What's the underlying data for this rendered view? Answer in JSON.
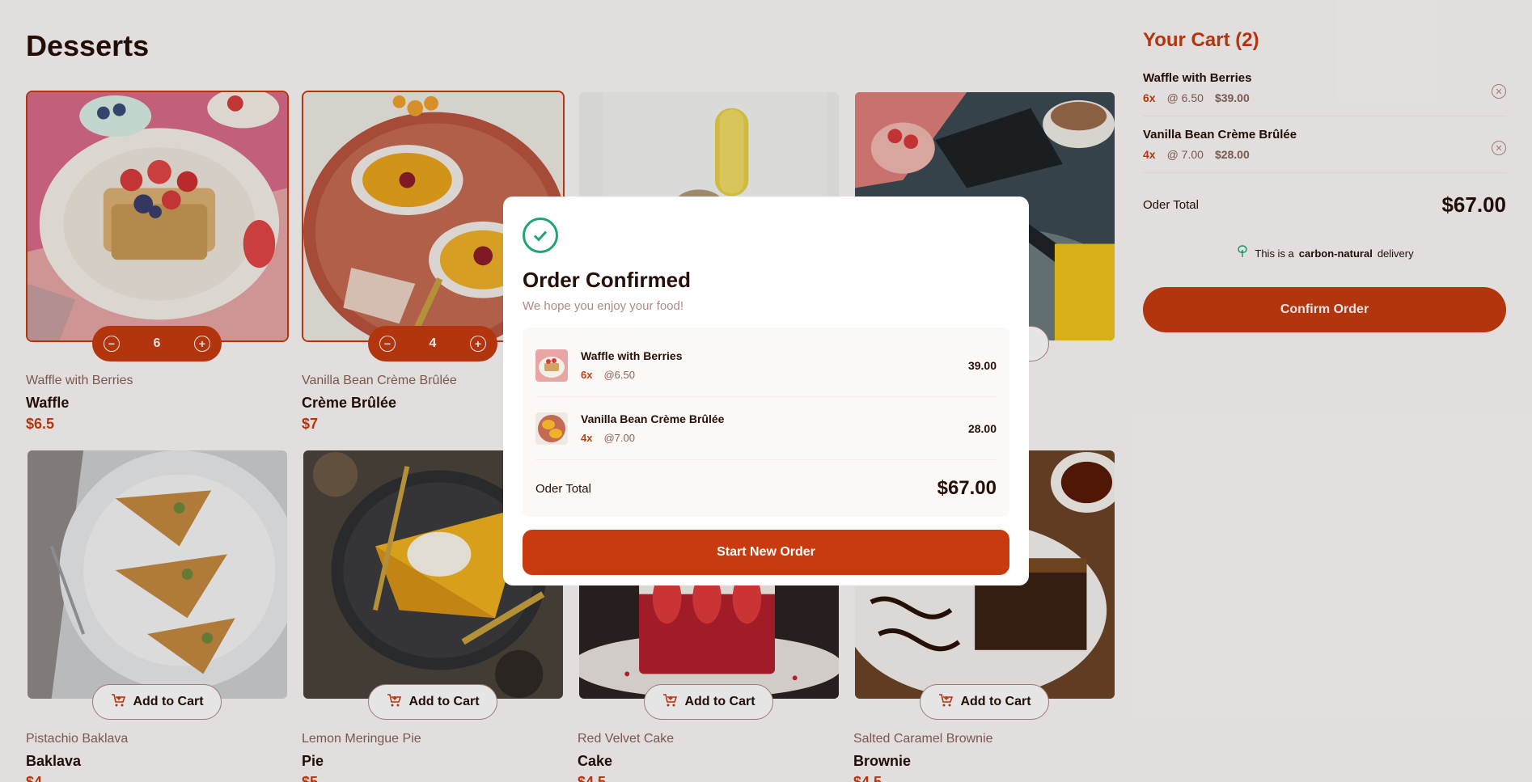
{
  "page": {
    "title": "Desserts"
  },
  "products": [
    {
      "category": "Waffle with Berries",
      "name": "Waffle",
      "price": "$6.5",
      "state": "qty",
      "qty": "6",
      "add_label": "Add to Cart"
    },
    {
      "category": "Vanilla Bean Crème Brûlée",
      "name": "Crème Brûlée",
      "price": "$7",
      "state": "qty",
      "qty": "4",
      "add_label": "Add to Cart"
    },
    {
      "category": "",
      "name": "",
      "price": "",
      "state": "add",
      "qty": "",
      "add_label": ""
    },
    {
      "category": "",
      "name": "",
      "price": "",
      "state": "add",
      "qty": "",
      "add_label": "t"
    },
    {
      "category": "Pistachio Baklava",
      "name": "Baklava",
      "price": "$4",
      "state": "add",
      "qty": "",
      "add_label": "Add to Cart"
    },
    {
      "category": "Lemon Meringue Pie",
      "name": "Pie",
      "price": "$5",
      "state": "add",
      "qty": "",
      "add_label": "Add to Cart"
    },
    {
      "category": "Red Velvet Cake",
      "name": "Cake",
      "price": "$4.5",
      "state": "add",
      "qty": "",
      "add_label": "Add to Cart"
    },
    {
      "category": "Salted Caramel Brownie",
      "name": "Brownie",
      "price": "$4.5",
      "state": "add",
      "qty": "",
      "add_label": "Add to Cart"
    }
  ],
  "cart": {
    "title": "Your Cart (2)",
    "items": [
      {
        "name": "Waffle with Berries",
        "qty": "6x",
        "unit": "@ 6.50",
        "total": "$39.00"
      },
      {
        "name": "Vanilla Bean Crème Brûlée",
        "qty": "4x",
        "unit": "@ 7.00",
        "total": "$28.00"
      }
    ],
    "total_label": "Oder Total",
    "total_value": "$67.00",
    "carbon_prefix": "This is a ",
    "carbon_bold": "carbon-natural",
    "carbon_suffix": " delivery",
    "confirm_label": "Confirm Order"
  },
  "modal": {
    "title": "Order Confirmed",
    "subtitle": "We hope you enjoy your food!",
    "items": [
      {
        "name": "Waffle with Berries",
        "qty": "6x",
        "unit": "@6.50",
        "price": "39.00"
      },
      {
        "name": "Vanilla Bean Crème Brûlée",
        "qty": "4x",
        "unit": "@7.00",
        "price": "28.00"
      }
    ],
    "total_label": "Oder Total",
    "total_value": "$67.00",
    "button_label": "Start New Order"
  },
  "icons": {
    "cart_add": "cart-plus-icon",
    "minus": "minus-circle-icon",
    "plus": "plus-circle-icon",
    "remove": "close-circle-icon",
    "tree": "tree-icon",
    "check": "check-circle-icon"
  },
  "colors": {
    "accent": "#c73b0f",
    "success": "#1ea575",
    "text": "#260f08",
    "muted": "#87635a"
  }
}
